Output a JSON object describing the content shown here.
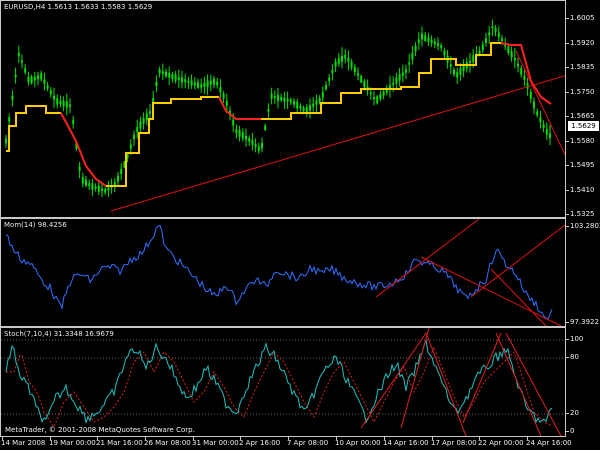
{
  "price_pane": {
    "label": "EURUSD,H4  1.5613 1.5633 1.5583 1.5629",
    "y_labels": [
      "1.6005",
      "1.5920",
      "1.5835",
      "1.5750",
      "1.5665",
      "1.5580",
      "1.5495",
      "1.5410",
      "1.5325"
    ],
    "y_values": [
      1.6005,
      1.592,
      1.5835,
      1.575,
      1.5665,
      1.558,
      1.5495,
      1.541,
      1.5325
    ],
    "current_price": "1.5629",
    "candle_color": "#00e000",
    "kijun_up_color": "#ffcc00",
    "kijun_down_color": "#ff2020",
    "trendline_color": "#dd1111"
  },
  "momentum_pane": {
    "label": "Mom(14) 98.4256",
    "y_top": "103.2802",
    "y_bottom": "97.3922",
    "line_color": "#3070ff",
    "trendline_color": "#dd1111"
  },
  "stochastic_pane": {
    "label": "Stoch(7,10,4) 31.3348 16.9679",
    "y_labels": [
      "100",
      "80",
      "20",
      "0"
    ],
    "main_color": "#20c0c0",
    "signal_color": "#dd2020"
  },
  "x_axis": {
    "labels": [
      "14 Mar 2008",
      "19 Mar 00:00",
      "21 Mar 16:00",
      "26 Mar 08:00",
      "31 Mar 00:00",
      "2 Apr 16:00",
      "7 Apr 08:00",
      "10 Apr 00:00",
      "14 Apr 16:00",
      "17 Apr 08:00",
      "22 Apr 00:00",
      "24 Apr 16:00"
    ]
  },
  "copyright": "MetaTrader, © 2001-2008 MetaQuotes Software Corp."
}
